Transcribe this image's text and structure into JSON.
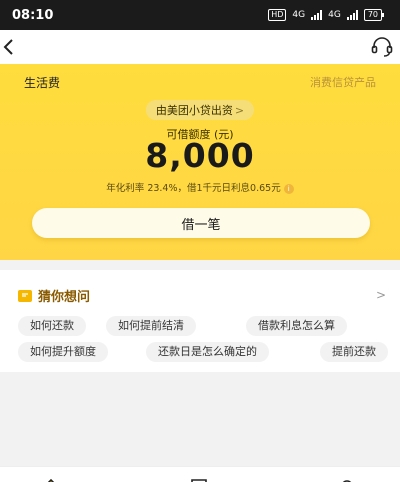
{
  "status_bar": {
    "time": "08:10",
    "hd_label": "HD",
    "network_label": "4G",
    "network_label_2": "4G",
    "battery": "70"
  },
  "hero": {
    "product_name": "生活费",
    "product_type": "消费信贷产品",
    "lender": "由美团小贷出资",
    "lender_chevron": ">",
    "limit_label": "可借额度 (元)",
    "limit_amount": "8,000",
    "rate_text": "年化利率 23.4%，借1千元日利息0.65元",
    "borrow_button": "借一笔",
    "colors": {
      "hero_bg": "#ffd84d",
      "button_bg": "#fffbe9",
      "accent": "#f5b700"
    }
  },
  "faq": {
    "title": "猜你想问",
    "more_chevron": ">",
    "row1": [
      "如何还款",
      "如何提前结清",
      "借款利息怎么算"
    ],
    "row2": [
      "如何提升额度",
      "还款日是怎么确定的",
      "提前还款"
    ]
  },
  "icons": {
    "back": "back-arrow-icon",
    "support": "headset-icon",
    "faq": "chat-bubble-icon",
    "info": "info-icon"
  }
}
